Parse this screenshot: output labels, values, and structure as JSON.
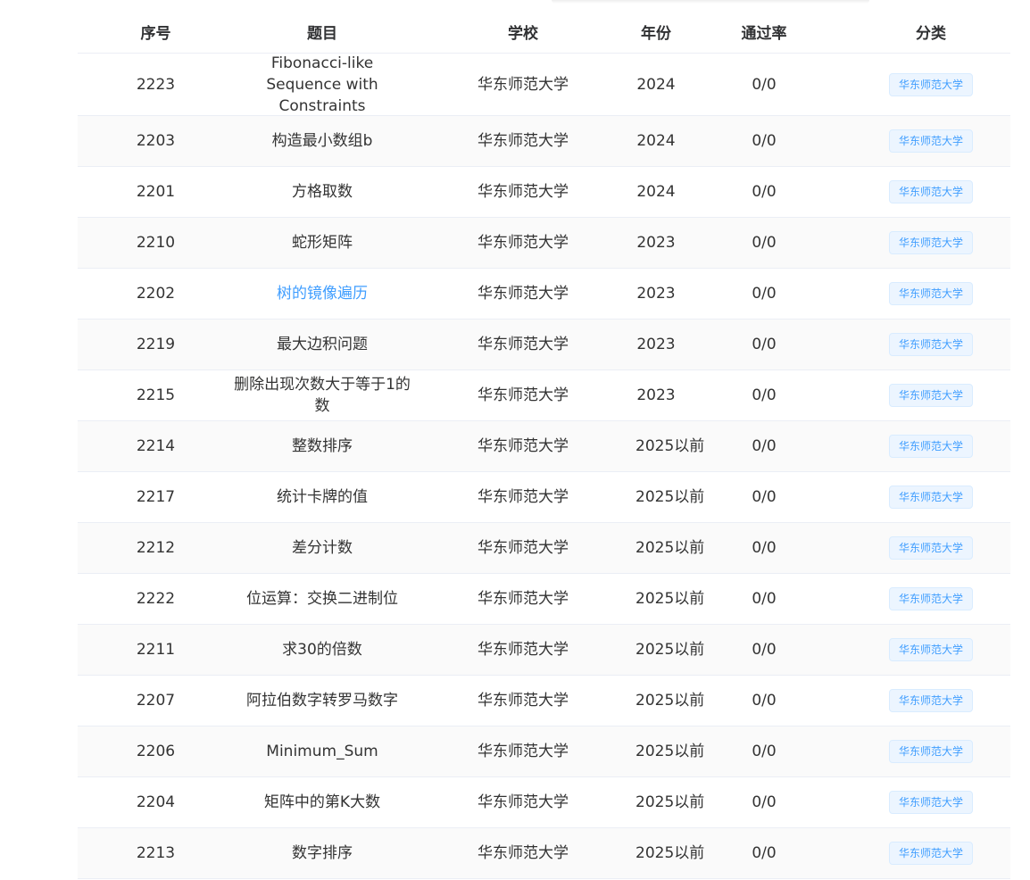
{
  "columns": {
    "id": "序号",
    "title": "题目",
    "school": "学校",
    "year": "年份",
    "pass_rate": "通过率",
    "category": "分类"
  },
  "rows": [
    {
      "id": "2223",
      "title": "Fibonacci-like Sequence with Constraints",
      "school": "华东师范大学",
      "year": "2024",
      "pass_rate": "0/0",
      "category": "华东师范大学"
    },
    {
      "id": "2203",
      "title": "构造最小数组b",
      "school": "华东师范大学",
      "year": "2024",
      "pass_rate": "0/0",
      "category": "华东师范大学"
    },
    {
      "id": "2201",
      "title": "方格取数",
      "school": "华东师范大学",
      "year": "2024",
      "pass_rate": "0/0",
      "category": "华东师范大学"
    },
    {
      "id": "2210",
      "title": "蛇形矩阵",
      "school": "华东师范大学",
      "year": "2023",
      "pass_rate": "0/0",
      "category": "华东师范大学"
    },
    {
      "id": "2202",
      "title": "树的镜像遍历",
      "school": "华东师范大学",
      "year": "2023",
      "pass_rate": "0/0",
      "category": "华东师范大学"
    },
    {
      "id": "2219",
      "title": "最大边积问题",
      "school": "华东师范大学",
      "year": "2023",
      "pass_rate": "0/0",
      "category": "华东师范大学"
    },
    {
      "id": "2215",
      "title": "删除出现次数大于等于1的数",
      "school": "华东师范大学",
      "year": "2023",
      "pass_rate": "0/0",
      "category": "华东师范大学"
    },
    {
      "id": "2214",
      "title": "整数排序",
      "school": "华东师范大学",
      "year": "2025以前",
      "pass_rate": "0/0",
      "category": "华东师范大学"
    },
    {
      "id": "2217",
      "title": "统计卡牌的值",
      "school": "华东师范大学",
      "year": "2025以前",
      "pass_rate": "0/0",
      "category": "华东师范大学"
    },
    {
      "id": "2212",
      "title": "差分计数",
      "school": "华东师范大学",
      "year": "2025以前",
      "pass_rate": "0/0",
      "category": "华东师范大学"
    },
    {
      "id": "2222",
      "title": "位运算：交换二进制位",
      "school": "华东师范大学",
      "year": "2025以前",
      "pass_rate": "0/0",
      "category": "华东师范大学"
    },
    {
      "id": "2211",
      "title": "求30的倍数",
      "school": "华东师范大学",
      "year": "2025以前",
      "pass_rate": "0/0",
      "category": "华东师范大学"
    },
    {
      "id": "2207",
      "title": "阿拉伯数字转罗马数字",
      "school": "华东师范大学",
      "year": "2025以前",
      "pass_rate": "0/0",
      "category": "华东师范大学"
    },
    {
      "id": "2206",
      "title": "Minimum_Sum",
      "school": "华东师范大学",
      "year": "2025以前",
      "pass_rate": "0/0",
      "category": "华东师范大学"
    },
    {
      "id": "2204",
      "title": "矩阵中的第K大数",
      "school": "华东师范大学",
      "year": "2025以前",
      "pass_rate": "0/0",
      "category": "华东师范大学"
    },
    {
      "id": "2213",
      "title": "数字排序",
      "school": "华东师范大学",
      "year": "2025以前",
      "pass_rate": "0/0",
      "category": "华东师范大学"
    }
  ],
  "colors": {
    "link": "#409eff",
    "tag_bg": "#ecf5ff",
    "tag_border": "#d9ecff",
    "stripe": "#fafafa",
    "divider": "#ebeef5"
  }
}
